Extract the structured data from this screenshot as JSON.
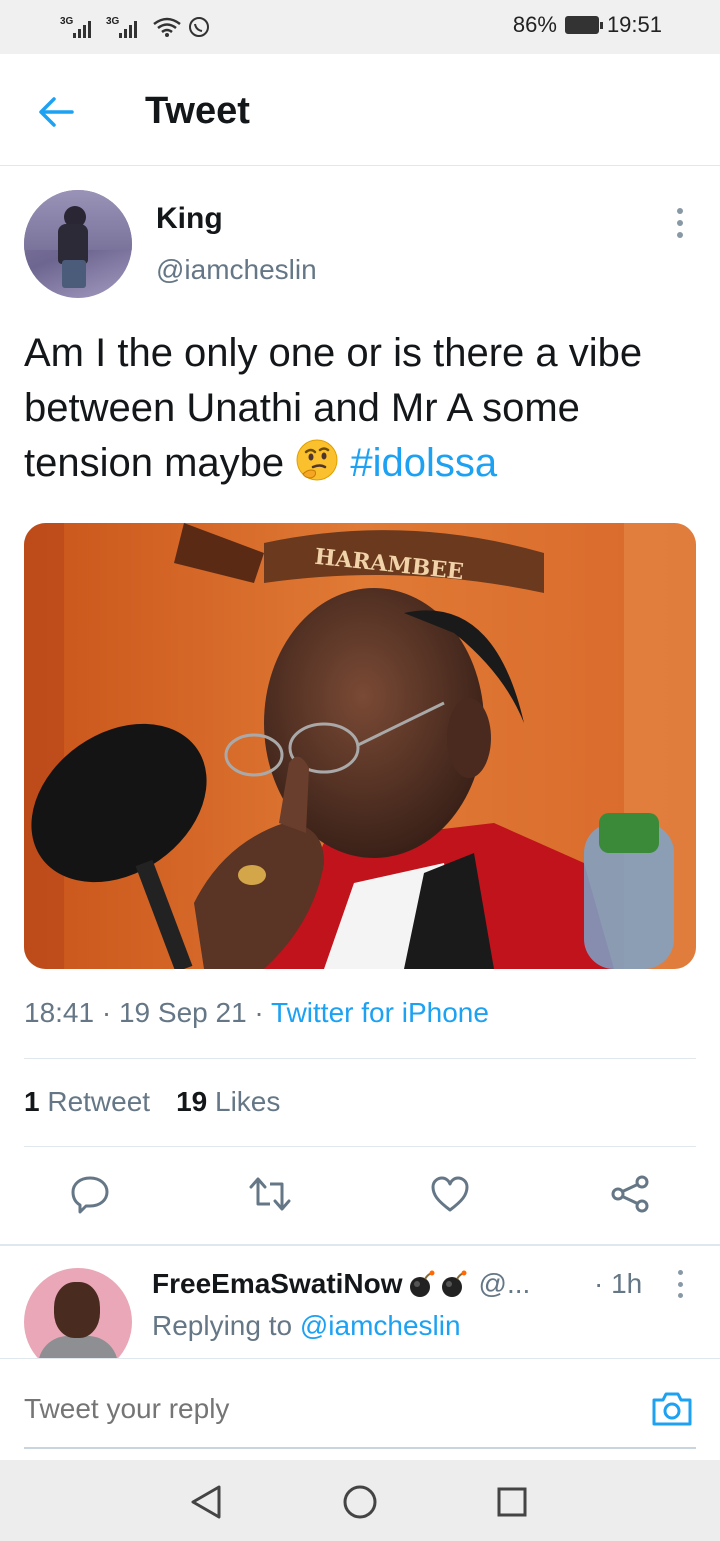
{
  "status_bar": {
    "network1": "3G",
    "network2": "3G",
    "battery": "86%",
    "time": "19:51"
  },
  "header": {
    "title": "Tweet"
  },
  "tweet": {
    "name": "King",
    "handle": "@iamcheslin",
    "text": "Am I the only one or is there a vibe between Unathi and Mr A some tension maybe ",
    "hashtag": "#idolssa",
    "time": "18:41",
    "date": "19 Sep 21",
    "source": "Twitter for iPhone",
    "retweet_count": "1",
    "retweet_label": "Retweet",
    "like_count": "19",
    "like_label": "Likes",
    "media_text": "HARAMBEE"
  },
  "reply": {
    "name": "FreeEmaSwatiNow",
    "handle": "@...",
    "time": "· 1h",
    "replying_prefix": "Replying to ",
    "replying_to": "@iamcheslin"
  },
  "compose": {
    "placeholder": "Tweet your reply"
  },
  "colors": {
    "accent": "#1da1f2",
    "secondary_text": "#657786"
  },
  "icons": [
    "back-arrow-icon",
    "more-icon",
    "thinking-face-emoji",
    "reply-icon",
    "retweet-icon",
    "like-icon",
    "share-icon",
    "bomb-emoji",
    "camera-icon",
    "nav-back-icon",
    "nav-home-icon",
    "nav-recents-icon"
  ]
}
